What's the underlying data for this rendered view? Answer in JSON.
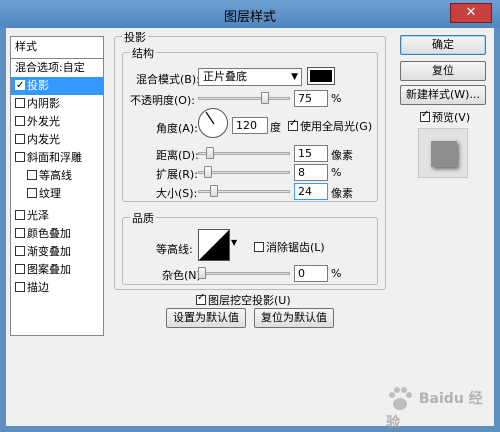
{
  "window": {
    "title": "图层样式",
    "close_label": "✕"
  },
  "style_list": {
    "header": "样式",
    "items": [
      {
        "label": "混合选项:自定",
        "checkbox": false
      },
      {
        "label": "投影",
        "checkbox": true,
        "checked": true,
        "selected": true
      },
      {
        "label": "内阴影",
        "checkbox": true,
        "checked": false
      },
      {
        "label": "外发光",
        "checkbox": true,
        "checked": false
      },
      {
        "label": "内发光",
        "checkbox": true,
        "checked": false
      },
      {
        "label": "斜面和浮雕",
        "checkbox": true,
        "checked": false
      },
      {
        "label": "等高线",
        "checkbox": true,
        "checked": false
      },
      {
        "label": "纹理",
        "checkbox": true,
        "checked": false
      },
      {
        "label": "光泽",
        "checkbox": true,
        "checked": false
      },
      {
        "label": "颜色叠加",
        "checkbox": true,
        "checked": false
      },
      {
        "label": "渐变叠加",
        "checkbox": true,
        "checked": false
      },
      {
        "label": "图案叠加",
        "checkbox": true,
        "checked": false
      },
      {
        "label": "描边",
        "checkbox": true,
        "checked": false
      }
    ]
  },
  "drop_shadow": {
    "section_title": "投影",
    "structure_title": "结构",
    "blend_mode_label": "混合模式(B):",
    "blend_mode_value": "正片叠底",
    "shadow_color": "#000000",
    "opacity_label": "不透明度(O):",
    "opacity_value": "75",
    "opacity_unit": "%",
    "opacity_fraction": 0.75,
    "angle_label": "角度(A):",
    "angle_value": "120",
    "angle_unit": "度",
    "use_global_light_label": "使用全局光(G)",
    "use_global_light": true,
    "distance_label": "距离(D):",
    "distance_value": "15",
    "distance_unit": "像素",
    "spread_label": "扩展(R):",
    "spread_value": "8",
    "spread_unit": "%",
    "size_label": "大小(S):",
    "size_value": "24",
    "size_unit": "像素",
    "quality_title": "品质",
    "contour_label": "等高线:",
    "anti_aliased_label": "消除锯齿(L)",
    "anti_aliased": false,
    "noise_label": "杂色(N):",
    "noise_value": "0",
    "noise_unit": "%",
    "knockout_label": "图层挖空投影(U)",
    "knockout": true,
    "make_default_label": "设置为默认值",
    "reset_default_label": "复位为默认值"
  },
  "right_panel": {
    "ok_label": "确定",
    "reset_label": "复位",
    "new_style_label": "新建样式(W)...",
    "preview_label": "预览(V)",
    "preview": true
  },
  "watermark": {
    "text": "Baidu 经验"
  }
}
